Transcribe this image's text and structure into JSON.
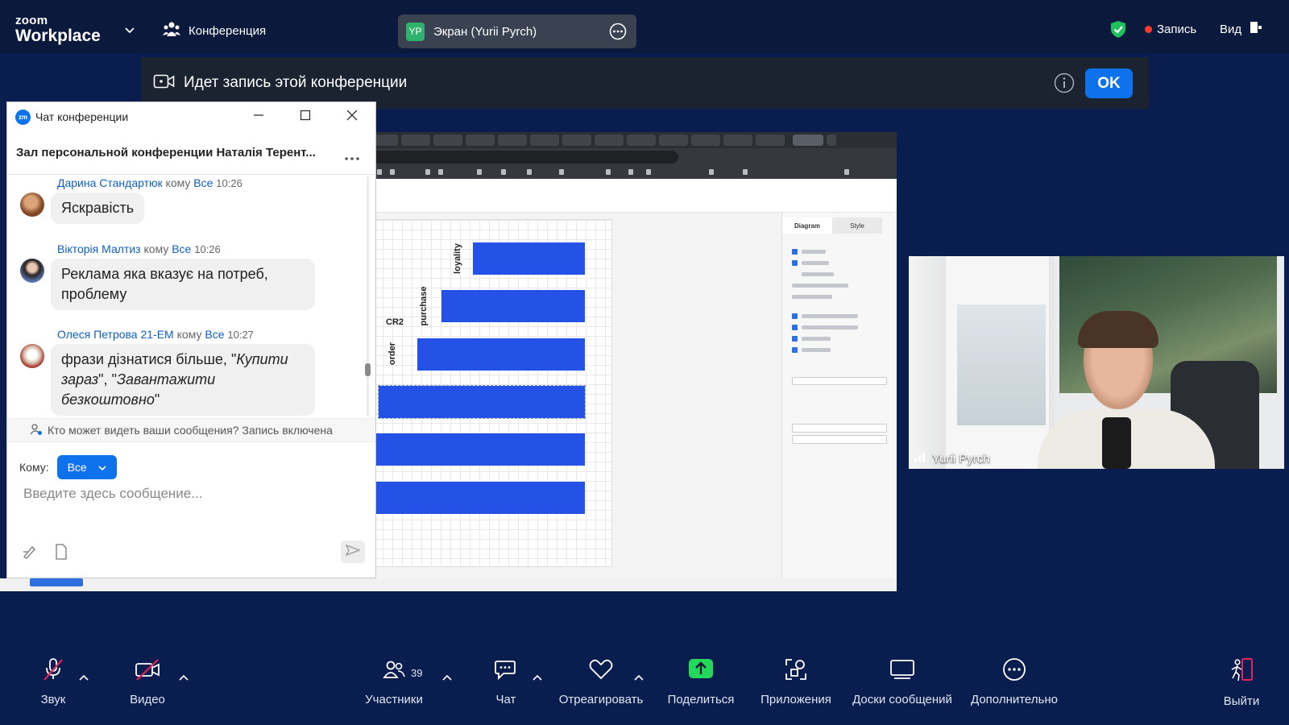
{
  "topbar": {
    "logo_top": "zoom",
    "logo_bottom": "Workplace",
    "conference_label": "Конференция",
    "share_badge": "YP",
    "share_label": "Экран (Yurii Pyrch)",
    "recording_label": "Запись",
    "view_label": "Вид"
  },
  "banner": {
    "text": "Идет запись этой конференции",
    "ok_label": "OK"
  },
  "shared_screen": {
    "bar_labels": [
      "loyality",
      "purchase",
      "order"
    ],
    "group_label": "CR2",
    "panel_tabs": [
      "Diagram",
      "Style"
    ]
  },
  "chat": {
    "window_title": "Чат конференции",
    "room_title": "Зал персональной конференции Наталія Терент...",
    "to_word": "кому",
    "messages": [
      {
        "sender": "Дарина Стандартюк",
        "to": "Все",
        "time": "10:26",
        "text": "Яскравість"
      },
      {
        "sender": "Вікторія Малтиз",
        "to": "Все",
        "time": "10:26",
        "text": "Реклама яка вказує на потреб, проблему"
      },
      {
        "sender": "Олеся Петрова 21-ЕМ",
        "to": "Все",
        "time": "10:27",
        "text_plain": "фрази дізнатися більше, \"",
        "text_it1": "Купити зараз",
        "text_mid": "\", \"",
        "text_it2": "Завантажити безкоштовно",
        "text_end": "\""
      }
    ],
    "notice": "Кто может видеть ваши сообщения? Запись включена",
    "to_label": "Кому:",
    "to_value": "Все",
    "input_placeholder": "Введите здесь сообщение..."
  },
  "video": {
    "participant_name": "Yurii Pyrch"
  },
  "toolbar": {
    "audio": "Звук",
    "video": "Видео",
    "participants": "Участники",
    "participants_count": "39",
    "chat": "Чат",
    "react": "Отреагировать",
    "share": "Поделиться",
    "apps": "Приложения",
    "whiteboards": "Доски сообщений",
    "more": "Дополнительно",
    "leave": "Выйти"
  },
  "colors": {
    "background": "#0a1d4f",
    "accent": "#0e72ed",
    "share_green": "#23d959",
    "leave_red": "#e0245e",
    "chart_bar": "#2451e6"
  },
  "icons": [
    "chevron-down-icon",
    "participants-icon",
    "more-icon",
    "shield-icon",
    "record-dot-icon",
    "view-icon",
    "camera-icon",
    "info-icon",
    "minimize-icon",
    "maximize-icon",
    "close-icon",
    "mic-muted-icon",
    "video-off-icon",
    "chat-icon",
    "heart-icon",
    "share-arrow-icon",
    "apps-icon",
    "whiteboard-icon",
    "leave-icon",
    "send-icon",
    "file-icon",
    "format-icon",
    "signal-icon"
  ]
}
